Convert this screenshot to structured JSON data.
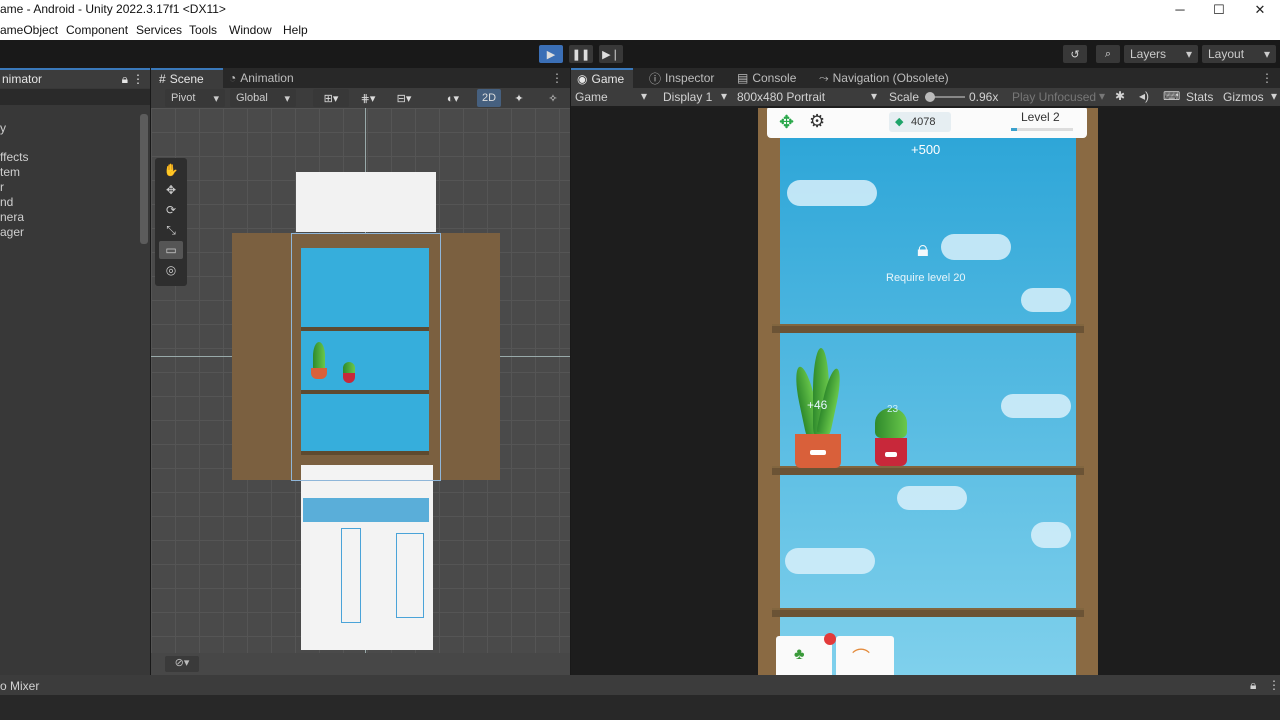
{
  "window": {
    "title": "ame - Android - Unity 2022.3.17f1 <DX11>"
  },
  "menu": [
    "ameObject",
    "Component",
    "Services",
    "Tools",
    "Window",
    "Help"
  ],
  "toolbar": {
    "layers_label": "Layers",
    "layout_label": "Layout"
  },
  "hierarchy": {
    "tab_label": "nimator",
    "items": [
      "y",
      "",
      "ffects",
      "tem",
      "r",
      "nd",
      "nera",
      "ager"
    ]
  },
  "scene": {
    "tabs": [
      "Scene",
      "Animation"
    ],
    "pivot_label": "Pivot",
    "global_label": "Global",
    "mode_2d": "2D"
  },
  "game": {
    "tabs": [
      "Game",
      "Inspector",
      "Console",
      "Navigation (Obsolete)"
    ],
    "mode_label": "Game",
    "display_label": "Display 1",
    "resolution_label": "800x480 Portrait",
    "scale_label": "Scale",
    "scale_value": "0.96x",
    "play_focus_label": "Play Unfocused",
    "stats_label": "Stats",
    "gizmos_label": "Gizmos",
    "hud": {
      "gems": "4078",
      "level": "Level 2",
      "bonus": "+500",
      "lock_text": "Require level 20",
      "plant_bonus": "+46",
      "plant2_value": "23"
    }
  },
  "status": {
    "mixer_label": "o Mixer"
  },
  "colors": {
    "accent": "#3a79bb",
    "play_button": "#3b6fb6",
    "sky": "#2ea6d8"
  },
  "icons": [
    "move-icon",
    "gear-icon",
    "gem-icon",
    "lock-icon",
    "plant-icon",
    "rainbow-icon",
    "play-icon",
    "pause-icon",
    "step-icon",
    "history-icon",
    "search-icon"
  ]
}
